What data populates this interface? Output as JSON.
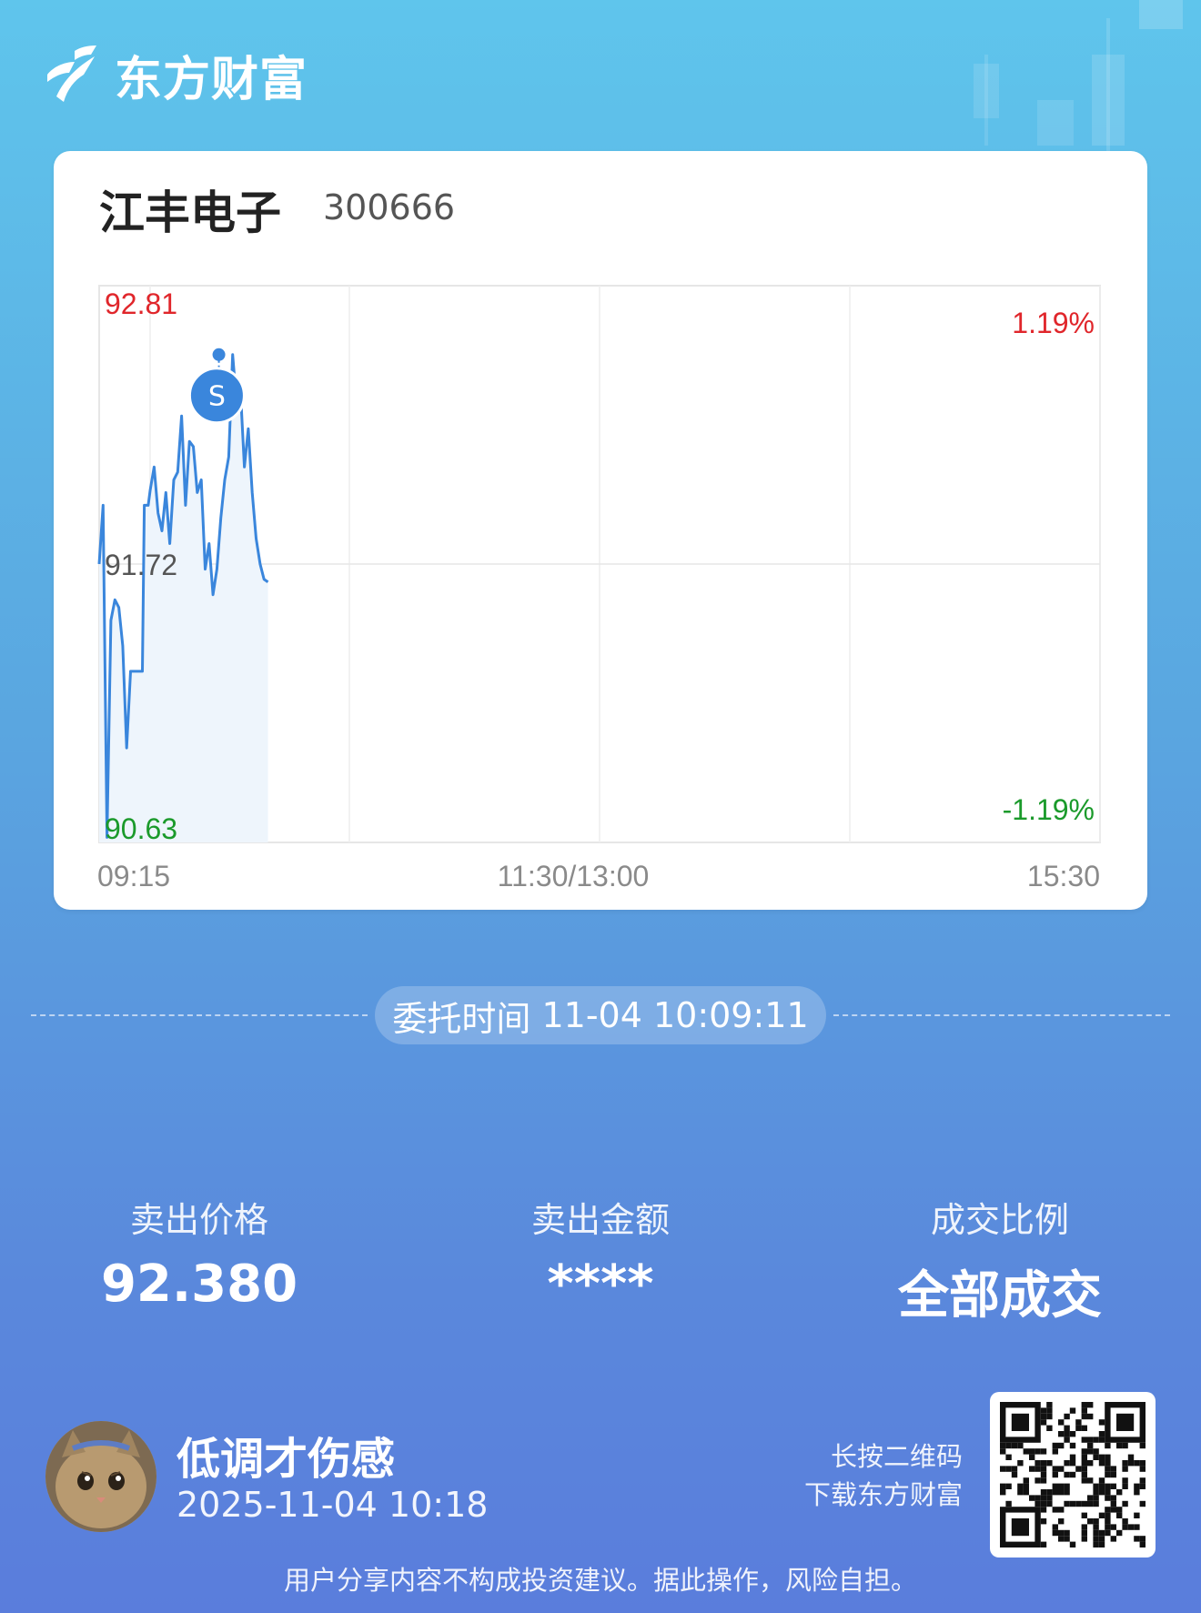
{
  "brand": {
    "name": "东方财富",
    "logo_icon": "eastmoney-logo-icon"
  },
  "stock": {
    "name": "江丰电子",
    "code": "300666"
  },
  "chart_data": {
    "type": "line",
    "price_high_label": "92.81",
    "price_mid_label": "91.72",
    "price_low_label": "90.63",
    "pct_high_label": "1.19%",
    "pct_low_label": "-1.19%",
    "x_tick_labels": [
      "09:15",
      "11:30/13:00",
      "15:30"
    ],
    "ylim": [
      90.63,
      92.81
    ],
    "prev_close": 91.72,
    "total_minutes": 255,
    "marker_label": "S",
    "marker_value": 92.38,
    "marker_minute": 30,
    "peak_minute": 30.5,
    "peak_value": 92.54,
    "series": [
      {
        "values": [
          [
            0,
            91.72
          ],
          [
            1,
            91.95
          ],
          [
            2,
            90.65
          ],
          [
            3,
            91.5
          ],
          [
            4,
            91.58
          ],
          [
            5,
            91.55
          ],
          [
            6,
            91.4
          ],
          [
            7,
            91.0
          ],
          [
            8,
            91.3
          ],
          [
            9,
            91.3
          ],
          [
            10,
            91.3
          ],
          [
            11,
            91.3
          ],
          [
            11.5,
            91.95
          ],
          [
            12.5,
            91.95
          ],
          [
            13,
            92.01
          ],
          [
            14,
            92.1
          ],
          [
            15,
            91.92
          ],
          [
            16,
            91.85
          ],
          [
            17,
            92.0
          ],
          [
            18,
            91.8
          ],
          [
            19,
            92.05
          ],
          [
            20,
            92.08
          ],
          [
            21,
            92.3
          ],
          [
            22,
            91.95
          ],
          [
            23,
            92.2
          ],
          [
            24,
            92.18
          ],
          [
            25,
            92.0
          ],
          [
            26,
            92.05
          ],
          [
            27,
            91.7
          ],
          [
            28,
            91.8
          ],
          [
            29,
            91.6
          ],
          [
            30,
            91.7
          ],
          [
            31,
            91.9
          ],
          [
            32,
            92.05
          ],
          [
            33,
            92.14
          ],
          [
            34,
            92.54
          ],
          [
            35,
            92.35
          ],
          [
            36,
            92.4
          ],
          [
            37,
            92.1
          ],
          [
            38,
            92.25
          ],
          [
            39,
            92.0
          ],
          [
            40,
            91.82
          ],
          [
            41,
            91.72
          ],
          [
            42,
            91.66
          ],
          [
            43,
            91.65
          ]
        ]
      }
    ],
    "line_color": "#3a86dc",
    "fill_color": "#eef5fc",
    "up_color": "#e0262b",
    "down_color": "#1b9a2b"
  },
  "order": {
    "time_label": "委托时间",
    "time_value": "11-04 10:09:11"
  },
  "stats": [
    {
      "label": "卖出价格",
      "value": "92.380"
    },
    {
      "label": "卖出金额",
      "value": "****"
    },
    {
      "label": "成交比例",
      "value": "全部成交"
    }
  ],
  "user": {
    "name": "低调才伤感",
    "share_time": "2025-11-04 10:18",
    "avatar_icon": "cat-avatar-icon"
  },
  "qr": {
    "hint_line1": "长按二维码",
    "hint_line2": "下载东方财富",
    "icon": "qr-code-icon"
  },
  "disclaimer": "用户分享内容不构成投资建议。据此操作，风险自担。"
}
